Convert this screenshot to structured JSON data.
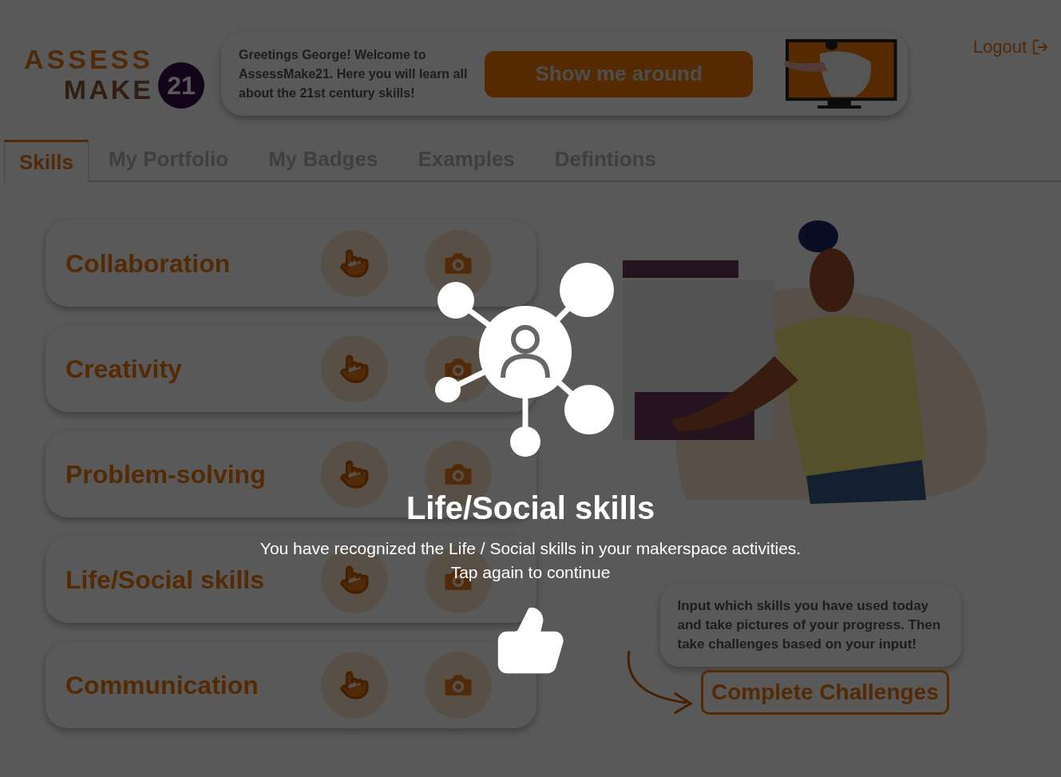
{
  "header": {
    "logo": {
      "line1": "ASSESS",
      "line2": "MAKE",
      "badge": "21"
    },
    "greeting": "Greetings George! Welcome to AssessMake21. Here you will learn all about the 21st century skills!",
    "tour_button": "Show me around",
    "logout": "Logout"
  },
  "tabs": [
    {
      "label": "Skills",
      "selected": true
    },
    {
      "label": "My Portfolio",
      "selected": false
    },
    {
      "label": "My Badges",
      "selected": false
    },
    {
      "label": "Examples",
      "selected": false
    },
    {
      "label": "Defintions",
      "selected": false
    }
  ],
  "skills": [
    {
      "name": "Collaboration"
    },
    {
      "name": "Creativity"
    },
    {
      "name": "Problem-solving"
    },
    {
      "name": "Life/Social skills"
    },
    {
      "name": "Communication"
    }
  ],
  "info_bubble": "Input which skills you have used today and take pictures of your progress. Then take challenges based on your input!",
  "challenges_button": "Complete Challenges",
  "overlay": {
    "title": "Life/Social skills",
    "message": "You have recognized the Life / Social skills in your makerspace activities.",
    "hint": "Tap again to continue"
  }
}
